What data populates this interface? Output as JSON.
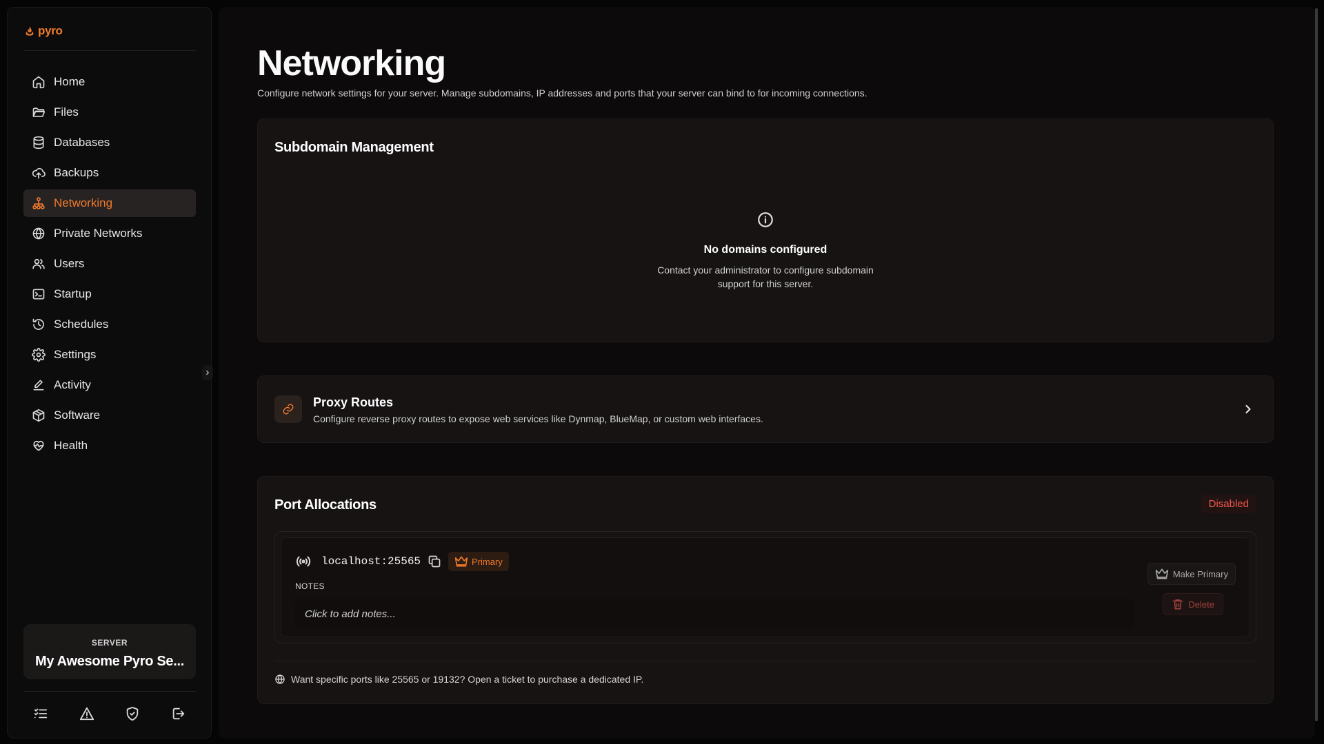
{
  "brand": {
    "name": "pyro",
    "accent": "#f07a2c"
  },
  "sidebar": {
    "items": [
      {
        "label": "Home",
        "icon": "home-icon"
      },
      {
        "label": "Files",
        "icon": "folder-icon"
      },
      {
        "label": "Databases",
        "icon": "database-icon"
      },
      {
        "label": "Backups",
        "icon": "cloud-upload-icon"
      },
      {
        "label": "Networking",
        "icon": "network-icon",
        "active": true
      },
      {
        "label": "Private Networks",
        "icon": "globe-icon"
      },
      {
        "label": "Users",
        "icon": "users-icon"
      },
      {
        "label": "Startup",
        "icon": "terminal-icon"
      },
      {
        "label": "Schedules",
        "icon": "clock-icon"
      },
      {
        "label": "Settings",
        "icon": "gear-icon"
      },
      {
        "label": "Activity",
        "icon": "pencil-icon"
      },
      {
        "label": "Software",
        "icon": "package-icon"
      },
      {
        "label": "Health",
        "icon": "heart-pulse-icon"
      }
    ],
    "server": {
      "label": "SERVER",
      "name": "My Awesome Pyro Se..."
    },
    "bottom_icons": [
      "list-icon",
      "warning-icon",
      "shield-icon",
      "logout-icon"
    ]
  },
  "page": {
    "title": "Networking",
    "description": "Configure network settings for your server. Manage subdomains, IP addresses and ports that your server can bind to for incoming connections."
  },
  "subdomain": {
    "title": "Subdomain Management",
    "empty_title": "No domains configured",
    "empty_desc": "Contact your administrator to configure subdomain support for this server."
  },
  "proxy": {
    "title": "Proxy Routes",
    "description": "Configure reverse proxy routes to expose web services like Dynmap, BlueMap, or custom web interfaces."
  },
  "ports": {
    "title": "Port Allocations",
    "status": "Disabled",
    "status_color": "#f0574d",
    "allocation": {
      "address": "localhost:25565",
      "primary_label": "Primary",
      "notes_label": "NOTES",
      "notes_placeholder": "Click to add notes...",
      "make_primary_label": "Make Primary",
      "delete_label": "Delete"
    },
    "footer": "Want specific ports like 25565 or 19132? Open a ticket to purchase a dedicated IP."
  }
}
